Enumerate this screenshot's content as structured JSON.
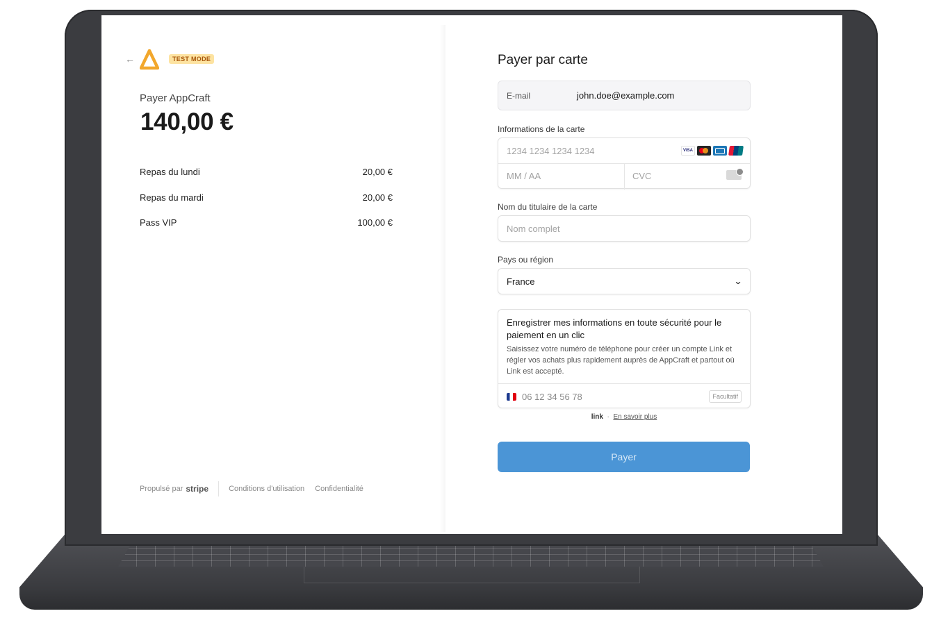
{
  "header": {
    "back_icon": "arrow-left-icon",
    "test_badge": "TEST MODE"
  },
  "summary": {
    "pay_to": "Payer AppCraft",
    "amount": "140,00 €",
    "items": [
      {
        "name": "Repas du lundi",
        "price": "20,00 €"
      },
      {
        "name": "Repas du mardi",
        "price": "20,00 €"
      },
      {
        "name": "Pass VIP",
        "price": "100,00 €"
      }
    ]
  },
  "footer": {
    "powered_by": "Propulsé par",
    "brand": "stripe",
    "terms": "Conditions d'utilisation",
    "privacy": "Confidentialité"
  },
  "payment": {
    "title": "Payer par carte",
    "email_label": "E-mail",
    "email_value": "john.doe@example.com",
    "card_label": "Informations de la carte",
    "card_number_placeholder": "1234 1234 1234 1234",
    "brands": [
      "visa",
      "mastercard",
      "cb",
      "unionpay"
    ],
    "visa_text": "VISA",
    "expiry_placeholder": "MM / AA",
    "cvc_placeholder": "CVC",
    "name_label": "Nom du titulaire de la carte",
    "name_placeholder": "Nom complet",
    "country_label": "Pays ou région",
    "country_value": "France",
    "link_title": "Enregistrer mes informations en toute sécurité pour le paiement en un clic",
    "link_desc": "Saisissez votre numéro de téléphone pour créer un compte Link et régler vos achats plus rapidement auprès de AppCraft et partout où Link est accepté.",
    "phone_placeholder": "06 12 34 56 78",
    "optional_label": "Facultatif",
    "link_logo": "link",
    "link_sep": "·",
    "learn_more": "En savoir plus",
    "pay_button": "Payer"
  },
  "colors": {
    "accent_button": "#4b95d6",
    "test_badge_bg": "#fde3a1",
    "laptop_body": "#3b3c40"
  }
}
